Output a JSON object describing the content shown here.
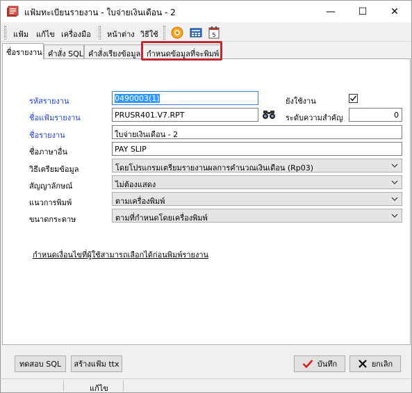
{
  "window": {
    "title": "แฟ้มทะเบียนรายงาน - ใบจ่ายเงินเดือน - 2",
    "minimize": "—",
    "maximize": "☐",
    "close": "✕"
  },
  "menu": {
    "items": [
      "แฟ้ม",
      "แก้ไข",
      "เครื่องมือ",
      "หน้าต่าง",
      "วิธีใช้"
    ],
    "toolbar_icons": [
      "help-circle-icon",
      "calculator-icon",
      "calendar-icon"
    ]
  },
  "tabs": [
    {
      "label": "ชื่อรายงาน",
      "active": true
    },
    {
      "label": "คำสั่ง SQL",
      "active": false
    },
    {
      "label": "คำสั่งเรียงข้อมูล",
      "active": false
    },
    {
      "label": "กำหนดข้อมูลที่จะพิมพ์",
      "active": false
    }
  ],
  "form": {
    "report_code_label": "รหัสรายงาน",
    "report_code_value": "0490003(1)",
    "report_file_label": "ชื่อแฟ้มรายงาน",
    "report_file_value": "PRUSR401.V7.RPT",
    "report_name_label": "ชื่อรายงาน",
    "report_name_value": "ใบจ่ายเงินเดือน - 2",
    "other_lang_label": "ชื่อภาษาอื่น",
    "other_lang_value": "PAY SLIP",
    "prep_method_label": "วิธีเตรียมข้อมูล",
    "prep_method_value": "โดยโปรแกรมเตรียมรายงานผลการคำนวณเงินเดือน (Rp03)",
    "symbol_label": "สัญญาลักษณ์",
    "symbol_value": "ไม่ต้องแสดง",
    "orientation_label": "แนวการพิมพ์",
    "orientation_value": "ตามเครื่องพิมพ์",
    "paper_size_label": "ขนาดกระดาษ",
    "paper_size_value": "ตามที่กำหนดโดยเครื่องพิมพ์",
    "in_use_label": "ยังใช้งาน",
    "in_use_checked": true,
    "priority_label": "ระดับความสำคัญ",
    "priority_value": "0",
    "condition_link": "กำหนดเงื่อนไขที่ผู้ใช้สามารถเลือกได้ก่อนพิมพ์รายงาน"
  },
  "buttons": {
    "test_sql": "ทดสอบ SQL",
    "create_ttx": "สร้างแฟ้ม ttx",
    "save": "บันทึก",
    "cancel": "ยกเลิก"
  },
  "status": {
    "mode": "แก้ไข"
  },
  "colors": {
    "link": "#1e3fd8",
    "highlight_box": "#c1272d",
    "selection": "#3399ff"
  }
}
